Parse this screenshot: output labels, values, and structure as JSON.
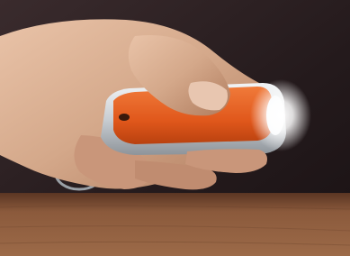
{
  "photo": {
    "subject": "hand-holding-keychain-flashlight",
    "colors": {
      "background_dark": "#2a1f21",
      "table_wood": "#8b5a3c",
      "skin": "#d4a88a",
      "skin_shadow": "#b07c5e",
      "device_body": "#e0571b",
      "device_trim": "#c9ced3",
      "light_glow": "#ffffff"
    }
  }
}
